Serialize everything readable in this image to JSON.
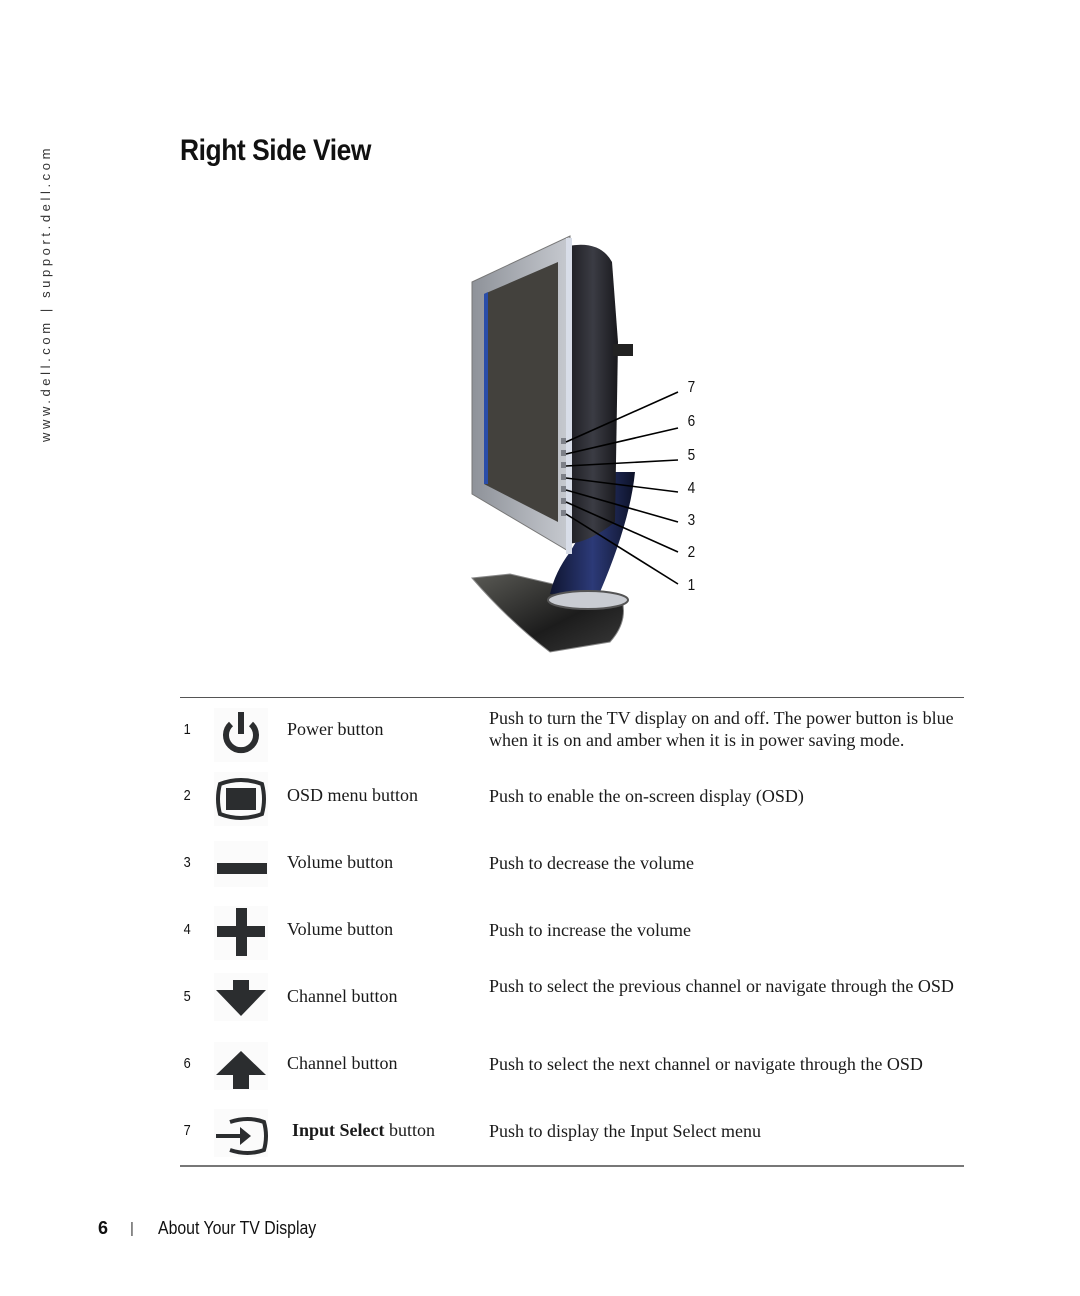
{
  "sidebar": {
    "url_text": "www.dell.com | support.dell.com"
  },
  "header": {
    "title": "Right Side View"
  },
  "figure": {
    "description": "Right side view of TV display showing side panel buttons",
    "callouts": [
      "7",
      "6",
      "5",
      "4",
      "3",
      "2",
      "1"
    ]
  },
  "table": {
    "rows": [
      {
        "number": "1",
        "icon": "power-icon",
        "name": "Power button",
        "name_bold_part": "",
        "description": "Push to turn the TV display on and off. The power button is blue when it is on and amber when it is in power saving mode."
      },
      {
        "number": "2",
        "icon": "osd-menu-icon",
        "name": "OSD menu button",
        "name_bold_part": "",
        "description": "Push to enable the on-screen display (OSD)"
      },
      {
        "number": "3",
        "icon": "minus-icon",
        "name": "Volume button",
        "name_bold_part": "",
        "description": "Push to decrease the volume"
      },
      {
        "number": "4",
        "icon": "plus-icon",
        "name": "Volume button",
        "name_bold_part": "",
        "description": "Push to increase the volume"
      },
      {
        "number": "5",
        "icon": "arrow-down-icon",
        "name": "Channel button",
        "name_bold_part": "",
        "description": "Push to select the previous channel or navigate through the OSD"
      },
      {
        "number": "6",
        "icon": "arrow-up-icon",
        "name": "Channel button",
        "name_bold_part": "",
        "description": "Push to select the next channel or navigate through the OSD"
      },
      {
        "number": "7",
        "icon": "input-select-icon",
        "name": " button",
        "name_bold_part": "Input Select",
        "description": "Push to display the Input Select menu"
      }
    ]
  },
  "footer": {
    "page_number": "6",
    "separator": "|",
    "section": "About Your TV Display"
  }
}
